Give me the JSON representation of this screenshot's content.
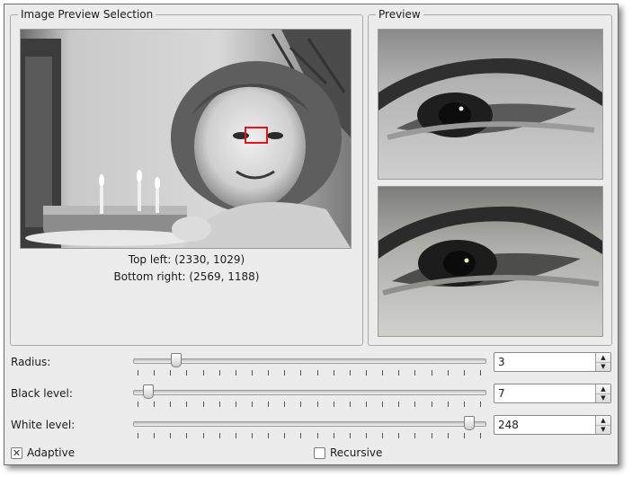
{
  "selection_panel": {
    "title": "Image Preview Selection",
    "top_left": "Top left: (2330, 1029)",
    "bottom_right": "Bottom right: (2569, 1188)"
  },
  "preview_panel": {
    "title": "Preview"
  },
  "controls": {
    "radius": {
      "label": "Radius:",
      "value": "3",
      "slider_fraction": 0.11
    },
    "black_level": {
      "label": "Black level:",
      "value": "7",
      "slider_fraction": 0.03
    },
    "white_level": {
      "label": "White level:",
      "value": "248",
      "slider_fraction": 0.97
    }
  },
  "options": {
    "adaptive": {
      "label": "Adaptive",
      "checked": true
    },
    "recursive": {
      "label": "Recursive",
      "checked": false
    }
  },
  "icons": {
    "spin_up": "arrow-up-icon",
    "spin_down": "arrow-down-icon",
    "check": "checkmark-icon"
  }
}
